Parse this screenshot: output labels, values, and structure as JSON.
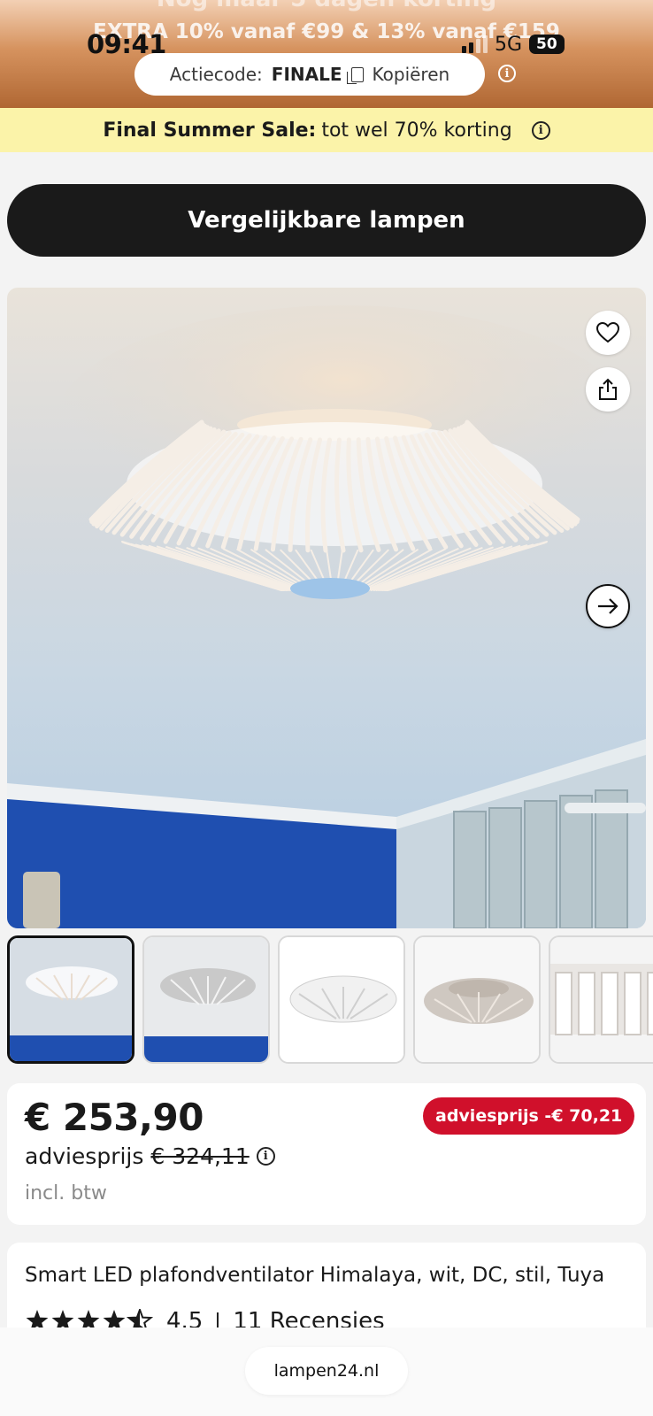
{
  "status_bar": {
    "time": "09:41",
    "network": "5G",
    "battery": "50"
  },
  "promo": {
    "ghost_line_1": "Nog maar 5 dagen korting",
    "ghost_line_2": "EXTRA 10% vanaf €99 & 13% vanaf €159",
    "code_label": "Actiecode:",
    "code_value": "FINALE",
    "copy_label": "Kopiëren"
  },
  "sale_banner": {
    "bold": "Final Summer Sale:",
    "text": "tot wel 70% korting"
  },
  "compare_button": "Vergelijkbare lampen",
  "gallery": {
    "thumbnail_count": 5,
    "active_index": 0
  },
  "price": {
    "current": "€ 253,90",
    "advies_label": "adviesprijs",
    "advies_value": "€ 324,11",
    "vat_note": "incl. btw",
    "discount_badge": "adviesprijs -€ 70,21"
  },
  "product": {
    "title": "Smart LED plafondventilator Himalaya, wit, DC, stil, Tuya",
    "rating": "4.5",
    "rating_value": 4.5,
    "reviews": "11 Recensies"
  },
  "browser": {
    "url": "lampen24.nl"
  },
  "colors": {
    "accent_dark": "#1a1a1a",
    "sale_yellow": "#fbf3a9",
    "discount_red": "#d0102b"
  }
}
